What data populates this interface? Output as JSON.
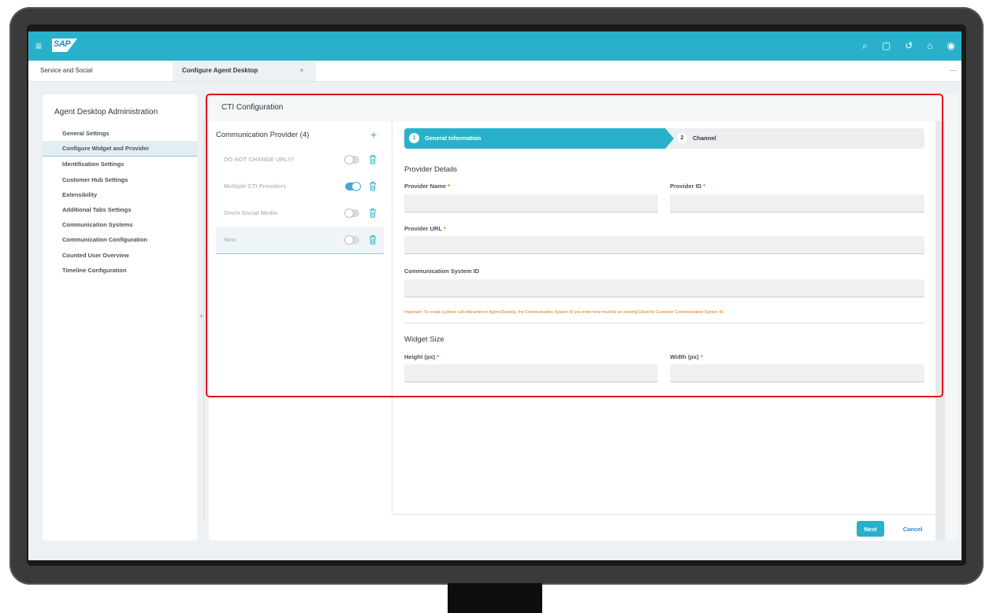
{
  "shell": {
    "logo": "SAP",
    "actions": [
      "search-icon",
      "feedback-icon",
      "history-icon",
      "notifications-icon",
      "user-icon"
    ]
  },
  "tabs": [
    {
      "label": "Service and Social"
    },
    {
      "label": "Configure Agent Desktop",
      "close": "×"
    }
  ],
  "tabs_more": "···",
  "nav": {
    "title": "Agent Desktop Administration",
    "items": [
      {
        "label": "General Settings"
      },
      {
        "label": "Configure Widget and Provider"
      },
      {
        "label": "Identification Settings"
      },
      {
        "label": "Customer Hub Settings"
      },
      {
        "label": "Extensibility"
      },
      {
        "label": "Additional Tabs Settings"
      },
      {
        "label": "Communication Systems"
      },
      {
        "label": "Communication Configuration"
      },
      {
        "label": "Counted User Overview"
      },
      {
        "label": "Timeline Configuration"
      }
    ],
    "active_index": 1
  },
  "cti": {
    "title": "CTI Configuration",
    "providers_header": "Communication Provider (4)",
    "add": "+",
    "providers": [
      {
        "name": "DO NOT CHANGE URL!!!",
        "enabled": false
      },
      {
        "name": "Multiple CTI Providers",
        "enabled": true
      },
      {
        "name": "Sinch Social Media",
        "enabled": false
      },
      {
        "name": "New",
        "enabled": false,
        "selected": true
      }
    ]
  },
  "wizard": {
    "steps": [
      {
        "num": "1",
        "label": "General Information",
        "active": true
      },
      {
        "num": "2",
        "label": "Channel",
        "active": false
      }
    ]
  },
  "form": {
    "provider_details_title": "Provider Details",
    "provider_name_label": "Provider Name",
    "provider_id_label": "Provider ID",
    "provider_url_label": "Provider URL",
    "comm_system_id_label": "Communication System ID",
    "required_mark": "*",
    "hint": "Important: To create a phone call interaction in Agent Desktop, the Communication System ID you enter here must be an existing Cloud for Customer Communication System ID.",
    "widget_size_title": "Widget Size",
    "height_label": "Height (px)",
    "width_label": "Width (px)",
    "values": {
      "provider_name": "",
      "provider_id": "",
      "provider_url": "",
      "comm_system_id": "",
      "height": "",
      "width": ""
    }
  },
  "footer": {
    "next": "Next",
    "cancel": "Cancel"
  },
  "colors": {
    "shellbar": "#29b1cc",
    "accent": "#29b1cc",
    "required": "#e9730c",
    "highlight": "#e5101f"
  }
}
